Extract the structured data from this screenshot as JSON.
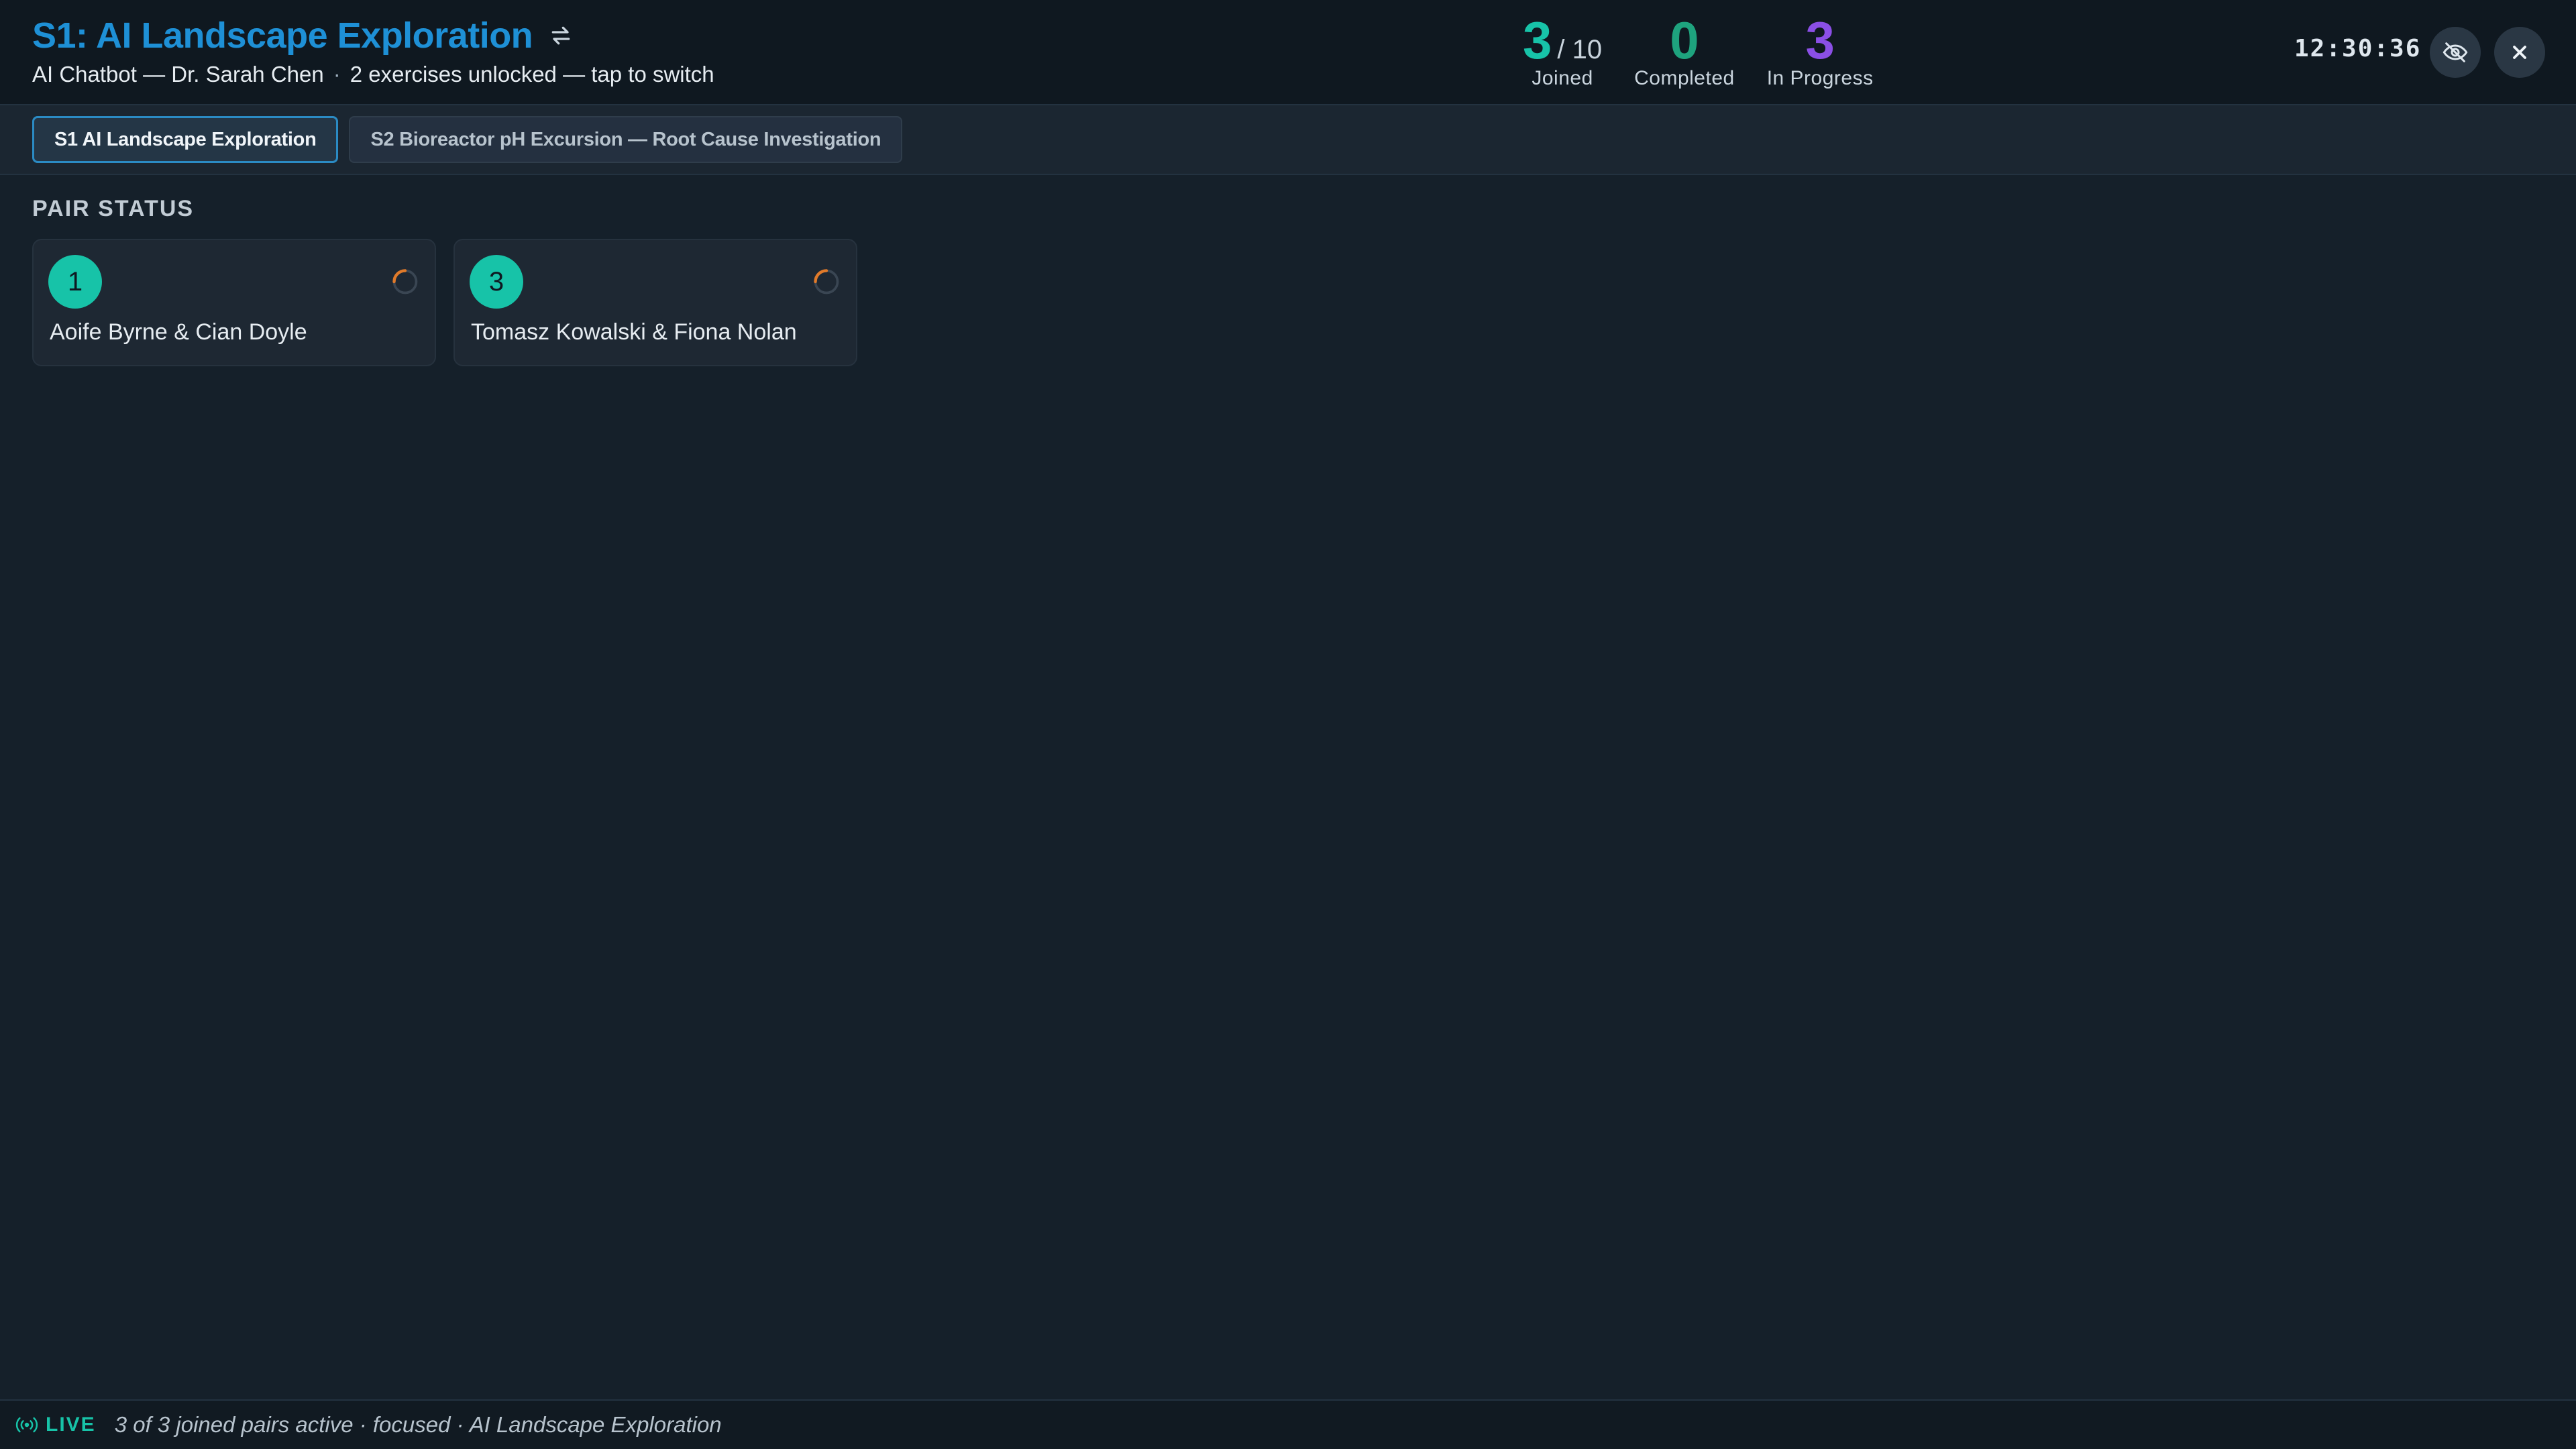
{
  "header": {
    "title": "S1: AI Landscape Exploration",
    "subtitle_main": "AI Chatbot — Dr. Sarah Chen",
    "subtitle_separator": "·",
    "subtitle_extra": "2 exercises unlocked — tap to switch",
    "clock": "12:30:36"
  },
  "stats": {
    "joined": {
      "value": "3",
      "suffix": "/ 10",
      "label": "Joined",
      "color": "#17c3a8"
    },
    "completed": {
      "value": "0",
      "label": "Completed",
      "color": "#1ea37e"
    },
    "in_progress": {
      "value": "3",
      "label": "In Progress",
      "color": "#8b4fe6"
    }
  },
  "icons": {
    "switch": "swap-arrows-icon",
    "hide": "eye-off-icon",
    "close": "close-icon",
    "pair_status": "spinner-icon",
    "live": "broadcast-icon"
  },
  "tabs": [
    {
      "label": "S1 AI Landscape Exploration",
      "active": true
    },
    {
      "label": "S2 Bioreactor pH Excursion — Root Cause Investigation",
      "active": false
    }
  ],
  "pair_status": {
    "title": "PAIR STATUS",
    "pairs": [
      {
        "number": "1",
        "names": "Aoife Byrne & Cian Doyle"
      },
      {
        "number": "3",
        "names": "Tomasz Kowalski & Fiona Nolan"
      }
    ]
  },
  "statusbar": {
    "live_label": "LIVE",
    "text": "3 of 3 joined pairs active · focused · AI Landscape Exploration"
  },
  "colors": {
    "accent_title": "#1e90d6",
    "teal": "#17c3a8",
    "spinner": "#e07a2a"
  }
}
